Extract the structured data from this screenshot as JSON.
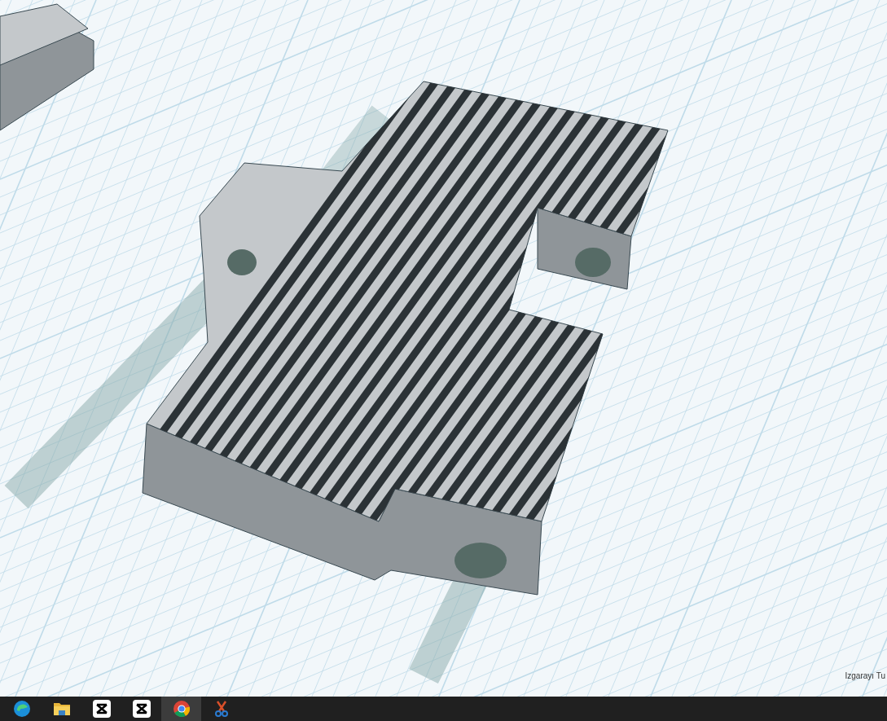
{
  "viewport": {
    "grid_label": "Izgarayı Tu"
  },
  "taskbar": {
    "apps": [
      {
        "kind": "swirl",
        "selected": false
      },
      {
        "kind": "folder",
        "selected": false
      },
      {
        "kind": "bowtie",
        "selected": false
      },
      {
        "kind": "bowtie",
        "selected": false
      },
      {
        "kind": "wheel",
        "selected": true
      },
      {
        "kind": "scissors",
        "selected": false
      }
    ]
  }
}
